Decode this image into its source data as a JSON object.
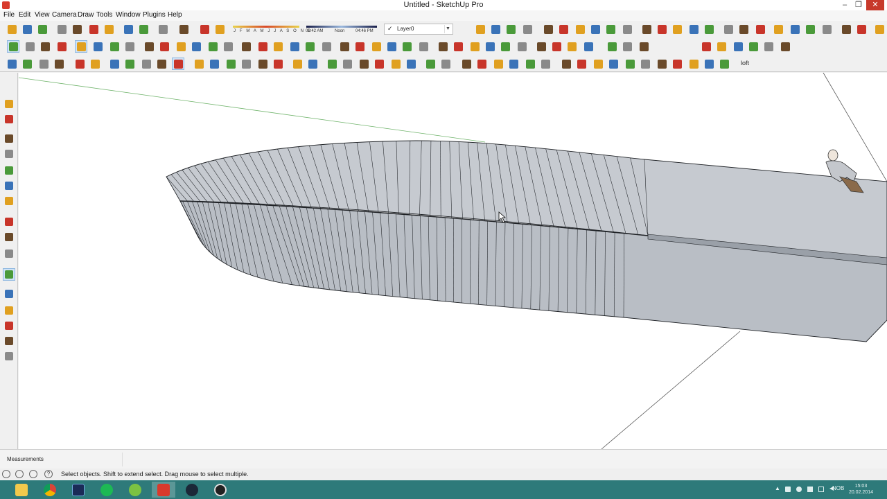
{
  "window": {
    "title": "Untitled - SketchUp Pro",
    "minimize_glyph": "–",
    "restore_glyph": "❐",
    "close_glyph": "✕"
  },
  "menu": {
    "items": [
      "File",
      "Edit",
      "View",
      "Camera",
      "Draw",
      "Tools",
      "Window",
      "Plugins",
      "Help"
    ]
  },
  "shadow_settings": {
    "months": "J F M A M J J A S O N D",
    "time_start": "06:42 AM",
    "time_noon": "Noon",
    "time_end": "04:46 PM"
  },
  "layer": {
    "check": "✓",
    "name": "Layer0",
    "arrow": "▼"
  },
  "plugin_toolbar": {
    "loft_label": "loft"
  },
  "measurements": {
    "label": "Measurements",
    "value": ""
  },
  "status": {
    "hint": "Select objects. Shift to extend select. Drag mouse to select multiple.",
    "help_glyph": "?"
  },
  "taskbar": {
    "tray_lang": "NOB",
    "time": "15:03",
    "date": "20.02.2014"
  },
  "colors": {
    "accent": "#2e7a7a",
    "tool_red": "#c8352a",
    "tool_orange": "#e0a020",
    "tool_blue": "#3a73b8",
    "tool_green": "#4a9a3a",
    "model_face": "#c3c7cd",
    "model_edge": "#1f2226"
  },
  "icons": {
    "select": "arrow-cursor-icon",
    "eraser": "eraser-icon",
    "paint": "paint-bucket-icon",
    "line": "pencil-icon",
    "orbit": "orbit-icon",
    "pan": "hand-icon",
    "zoom": "magnifier-icon"
  }
}
